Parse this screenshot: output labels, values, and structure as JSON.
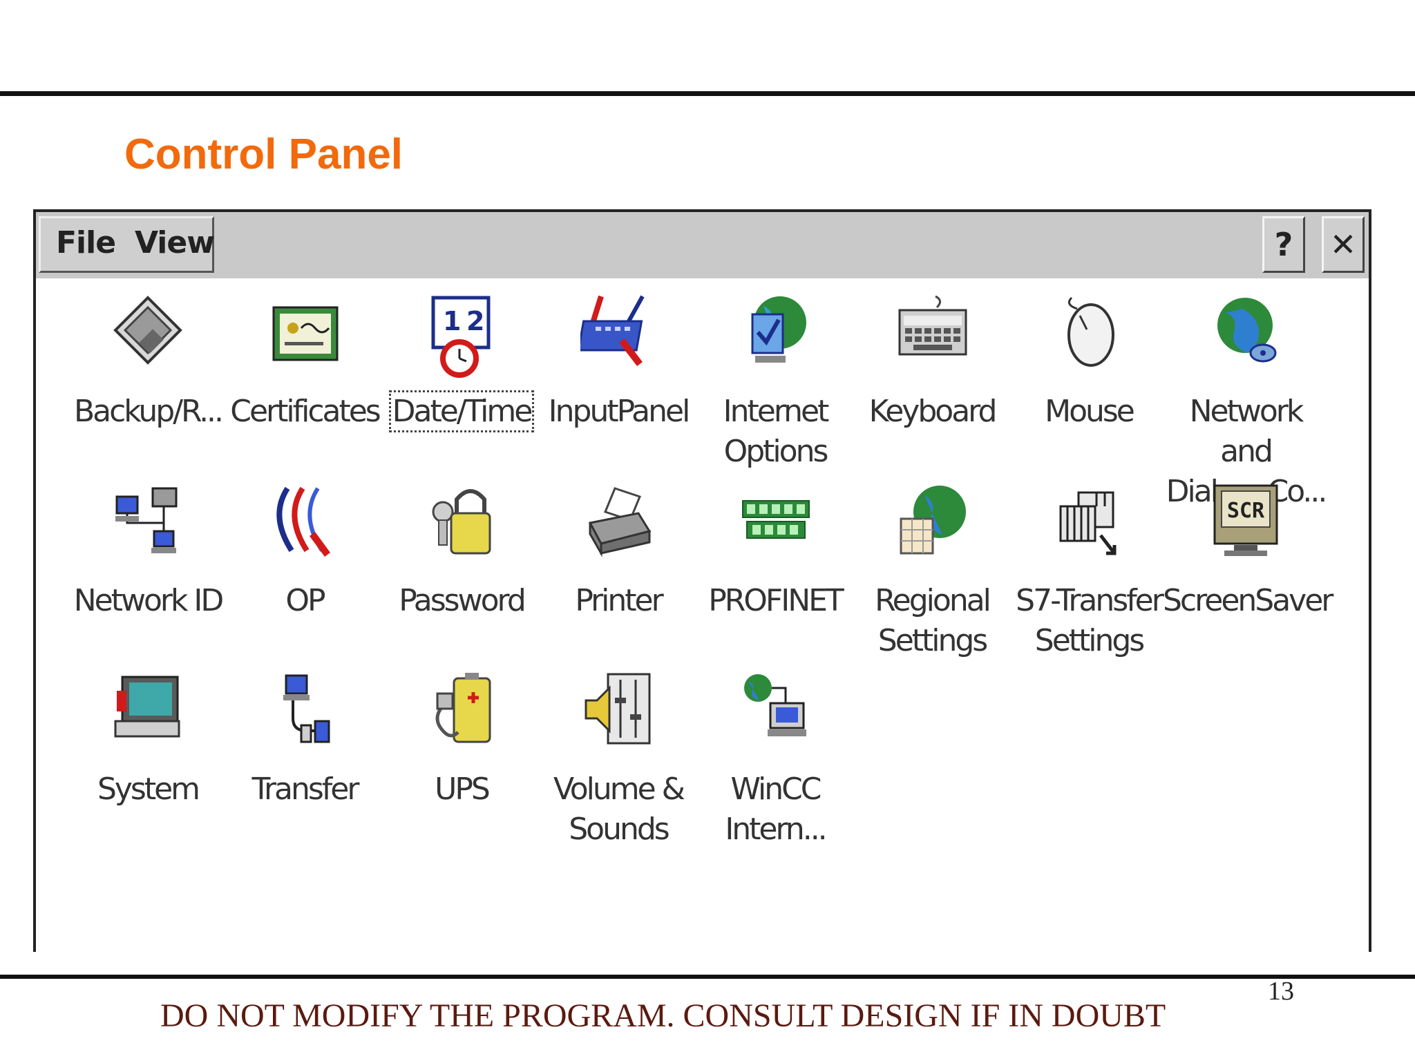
{
  "slide": {
    "title": "Control Panel",
    "footer": "DO NOT MODIFY THE PROGRAM. CONSULT DESIGN IF IN DOUBT",
    "page_number": "13",
    "title_color": "#f26a0c"
  },
  "window": {
    "menu": {
      "file": "File",
      "view": "View"
    },
    "help_label": "?",
    "close_label": "✕"
  },
  "icons": [
    {
      "label1": "Backup/R...",
      "label2": "",
      "icon": "backup-icon"
    },
    {
      "label1": "Certificates",
      "label2": "",
      "icon": "certificate-icon"
    },
    {
      "label1": "Date/Time",
      "label2": "",
      "icon": "calendar-clock-icon",
      "selected": true
    },
    {
      "label1": "InputPanel",
      "label2": "",
      "icon": "keyboard-pen-icon"
    },
    {
      "label1": "Internet",
      "label2": "Options",
      "icon": "globe-check-icon"
    },
    {
      "label1": "Keyboard",
      "label2": "",
      "icon": "keyboard-icon"
    },
    {
      "label1": "Mouse",
      "label2": "",
      "icon": "mouse-icon"
    },
    {
      "label1": "Network and",
      "label2": "Dial-up Co...",
      "icon": "network-globe-icon"
    },
    {
      "label1": "Network ID",
      "label2": "",
      "icon": "network-computers-icon"
    },
    {
      "label1": "OP",
      "label2": "",
      "icon": "op-icon"
    },
    {
      "label1": "Password",
      "label2": "",
      "icon": "padlock-icon"
    },
    {
      "label1": "Printer",
      "label2": "",
      "icon": "printer-icon"
    },
    {
      "label1": "PROFINET",
      "label2": "",
      "icon": "profinet-icon"
    },
    {
      "label1": "Regional",
      "label2": "Settings",
      "icon": "regional-globe-icon"
    },
    {
      "label1": "S7-Transfer",
      "label2": "Settings",
      "icon": "s7-transfer-icon"
    },
    {
      "label1": "ScreenSaver",
      "label2": "",
      "icon": "screensaver-monitor-icon",
      "badge": "SCR"
    },
    {
      "label1": "System",
      "label2": "",
      "icon": "system-computer-icon"
    },
    {
      "label1": "Transfer",
      "label2": "",
      "icon": "transfer-icon"
    },
    {
      "label1": "UPS",
      "label2": "",
      "icon": "battery-plug-icon"
    },
    {
      "label1": "Volume &",
      "label2": "Sounds",
      "icon": "speaker-mixer-icon"
    },
    {
      "label1": "WinCC",
      "label2": "Intern...",
      "icon": "wincc-network-icon"
    }
  ]
}
